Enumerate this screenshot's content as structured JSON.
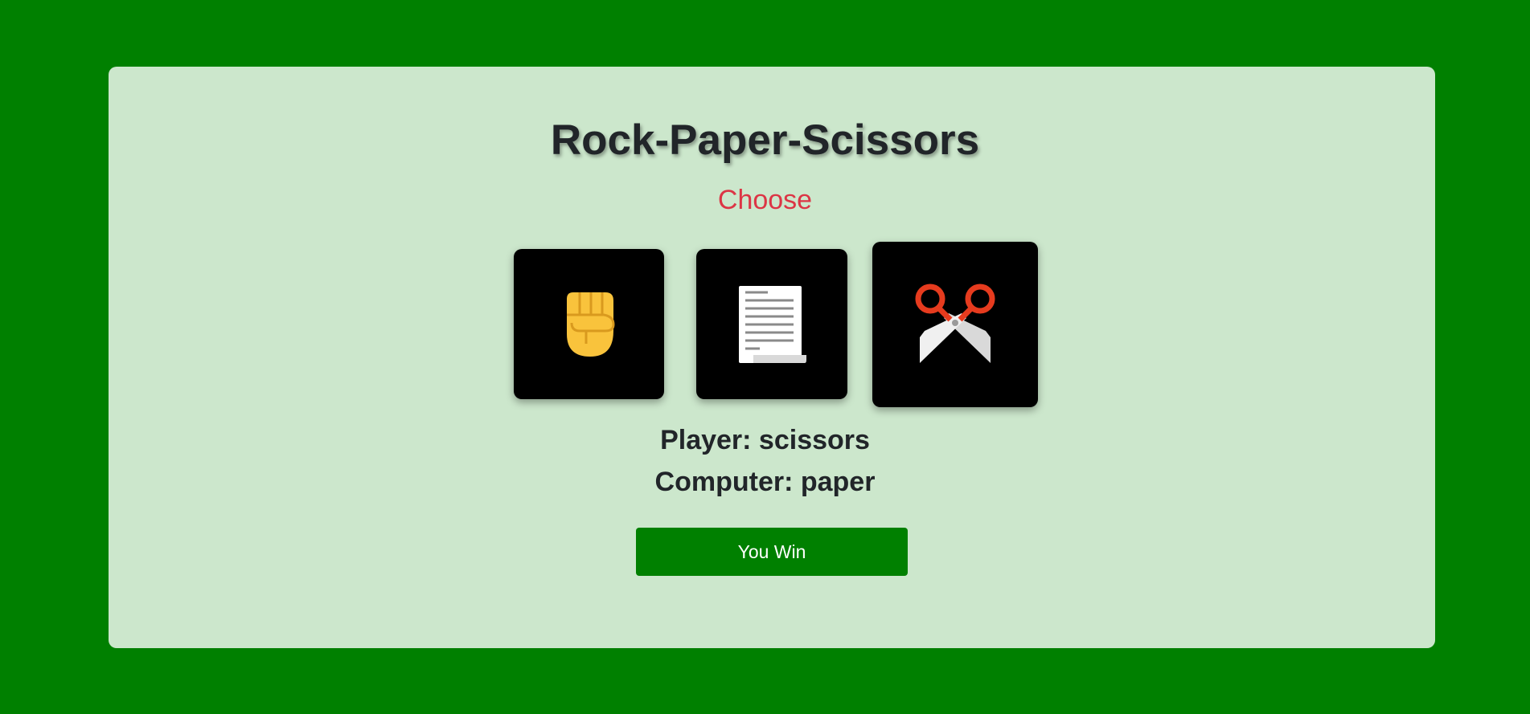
{
  "page": {
    "title": "Rock-Paper-Scissors",
    "subtitle": "Choose"
  },
  "choices": [
    {
      "id": "rock",
      "icon": "raised-fist-icon"
    },
    {
      "id": "paper",
      "icon": "page-document-icon"
    },
    {
      "id": "scissors",
      "icon": "scissors-icon"
    }
  ],
  "result": {
    "player_text": "Player: scissors",
    "computer_text": "Computer: paper",
    "outcome_label": "You Win"
  },
  "colors": {
    "background": "#008000",
    "panel": "#cce7cc",
    "title": "#212529",
    "subtitle": "#dc3545",
    "button": "#008000",
    "choice_tile": "#000000"
  }
}
